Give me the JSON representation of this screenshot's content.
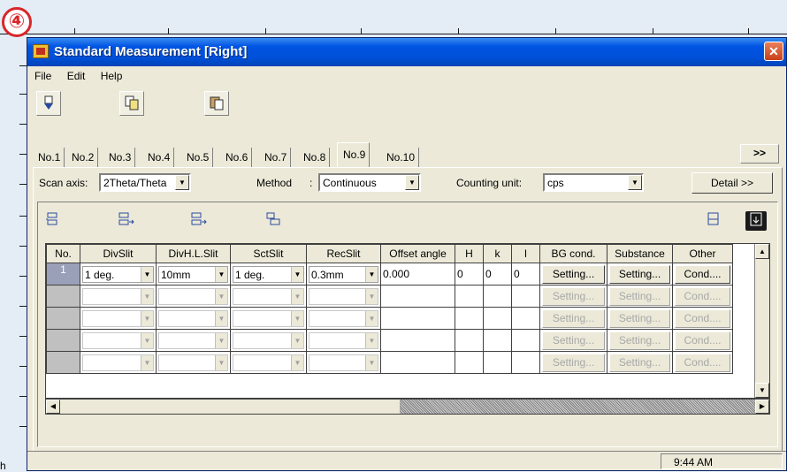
{
  "badge": "④",
  "background_fragment": "h",
  "window": {
    "title": "Standard Measurement [Right]",
    "close": "✕"
  },
  "menu": [
    "File",
    "Edit",
    "Help"
  ],
  "tabs": [
    "No.1",
    "No.2",
    "No.3",
    "No.4",
    "No.5",
    "No.6",
    "No.7",
    "No.8",
    "No.9",
    "No.10"
  ],
  "active_tab": "No.9",
  "tabs_more": ">>",
  "conditions": {
    "scan_axis_label": "Scan axis:",
    "scan_axis_value": "2Theta/Theta",
    "method_label": "Method",
    "method_colon": ":",
    "method_value": "Continuous",
    "counting_unit_label": "Counting unit:",
    "counting_unit_value": "cps",
    "detail_button": "Detail >>"
  },
  "grid": {
    "headers": [
      "No.",
      "DivSlit",
      "DivH.L.Slit",
      "SctSlit",
      "RecSlit",
      "Offset angle",
      "H",
      "k",
      "l",
      "BG cond.",
      "Substance",
      "Other"
    ],
    "rows": [
      {
        "no": "1",
        "divslit": "1 deg.",
        "divhl": "10mm",
        "sctslit": "1 deg.",
        "recslit": "0.3mm",
        "offset": "0.000",
        "h": "0",
        "k": "0",
        "l": "0",
        "bg": "Setting...",
        "substance": "Setting...",
        "other": "Cond...."
      },
      {
        "no": "",
        "divslit": "",
        "divhl": "",
        "sctslit": "",
        "recslit": "",
        "offset": "",
        "h": "",
        "k": "",
        "l": "",
        "bg": "Setting...",
        "substance": "Setting...",
        "other": "Cond...."
      },
      {
        "no": "",
        "divslit": "",
        "divhl": "",
        "sctslit": "",
        "recslit": "",
        "offset": "",
        "h": "",
        "k": "",
        "l": "",
        "bg": "Setting...",
        "substance": "Setting...",
        "other": "Cond...."
      },
      {
        "no": "",
        "divslit": "",
        "divhl": "",
        "sctslit": "",
        "recslit": "",
        "offset": "",
        "h": "",
        "k": "",
        "l": "",
        "bg": "Setting...",
        "substance": "Setting...",
        "other": "Cond...."
      },
      {
        "no": "",
        "divslit": "",
        "divhl": "",
        "sctslit": "",
        "recslit": "",
        "offset": "",
        "h": "",
        "k": "",
        "l": "",
        "bg": "Setting...",
        "substance": "Setting...",
        "other": "Cond...."
      }
    ]
  },
  "status": {
    "time": "9:44 AM"
  },
  "icons": {
    "toolbar": [
      "download-icon",
      "copy-icon",
      "paste-icon"
    ],
    "row_tools": [
      "insert-row-icon",
      "append-row-icon",
      "move-row-icon",
      "duplicate-row-icon",
      "sort-icon",
      "save-icon"
    ]
  }
}
